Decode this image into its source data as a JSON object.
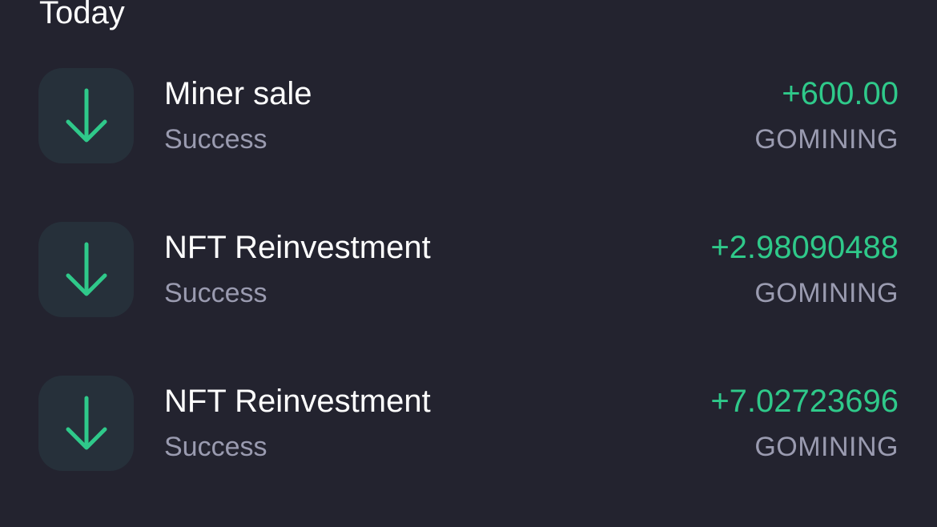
{
  "section": {
    "title": "Today"
  },
  "colors": {
    "background": "#23232f",
    "icon_background": "#26303a",
    "accent_green": "#2fc98a",
    "muted_text": "#9a9bb0",
    "primary_text": "#ffffff"
  },
  "transactions": [
    {
      "icon": "arrow-down-icon",
      "title": "Miner sale",
      "status": "Success",
      "amount": "+600.00",
      "currency": "GOMINING"
    },
    {
      "icon": "arrow-down-icon",
      "title": "NFT Reinvestment",
      "status": "Success",
      "amount": "+2.98090488",
      "currency": "GOMINING"
    },
    {
      "icon": "arrow-down-icon",
      "title": "NFT Reinvestment",
      "status": "Success",
      "amount": "+7.02723696",
      "currency": "GOMINING"
    }
  ]
}
